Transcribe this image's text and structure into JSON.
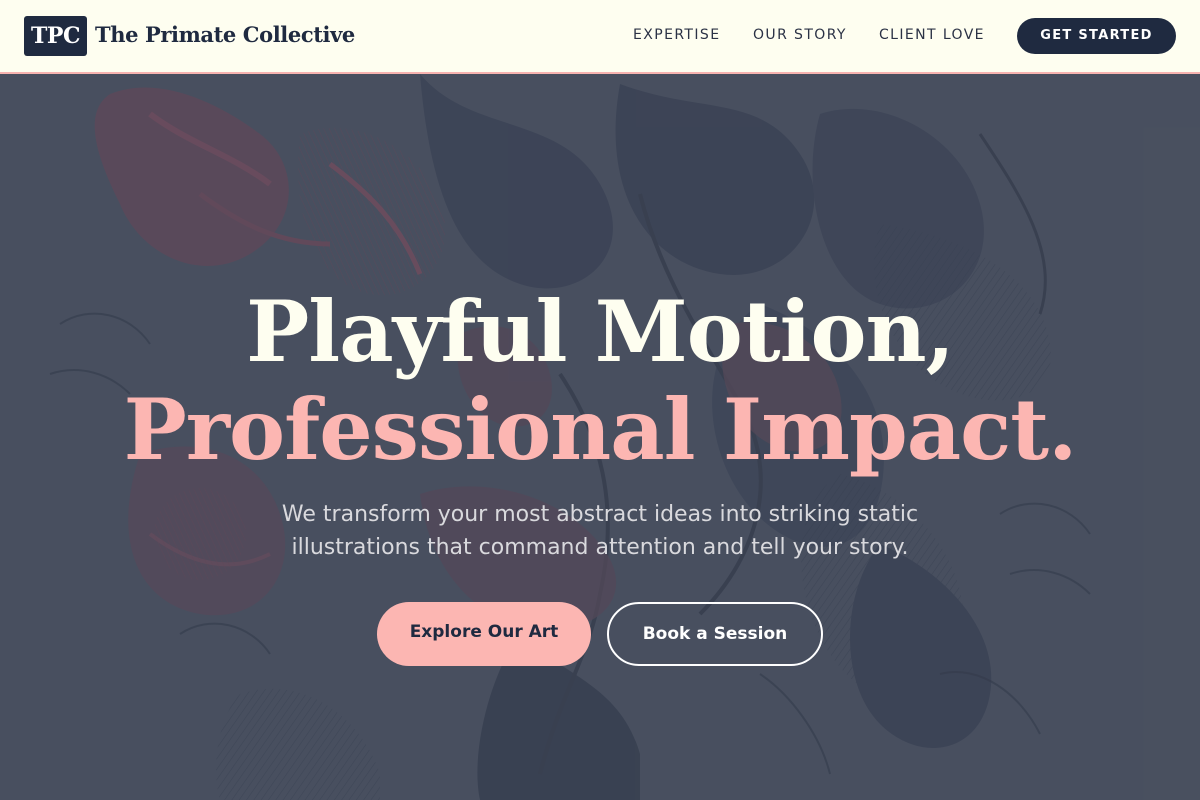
{
  "header": {
    "logo_text": "TPC",
    "brand_name": "The Primate Collective",
    "nav": [
      "EXPERTISE",
      "OUR STORY",
      "CLIENT LOVE"
    ],
    "cta_label": "GET STARTED"
  },
  "hero": {
    "headline_line1": "Playful Motion,",
    "headline_line2": "Professional Impact.",
    "subtext": "We transform your most abstract ideas into striking static illustrations that command attention and tell your story.",
    "primary_button": "Explore Our Art",
    "secondary_button": "Book a Session",
    "background_image": "botanical-engraving-illustration"
  },
  "colors": {
    "header_bg": "#fefef0",
    "navy": "#1f2a40",
    "accent_pink": "#fcb6b2",
    "hero_bg": "#4a5160",
    "headline_cream": "#fefef0"
  }
}
